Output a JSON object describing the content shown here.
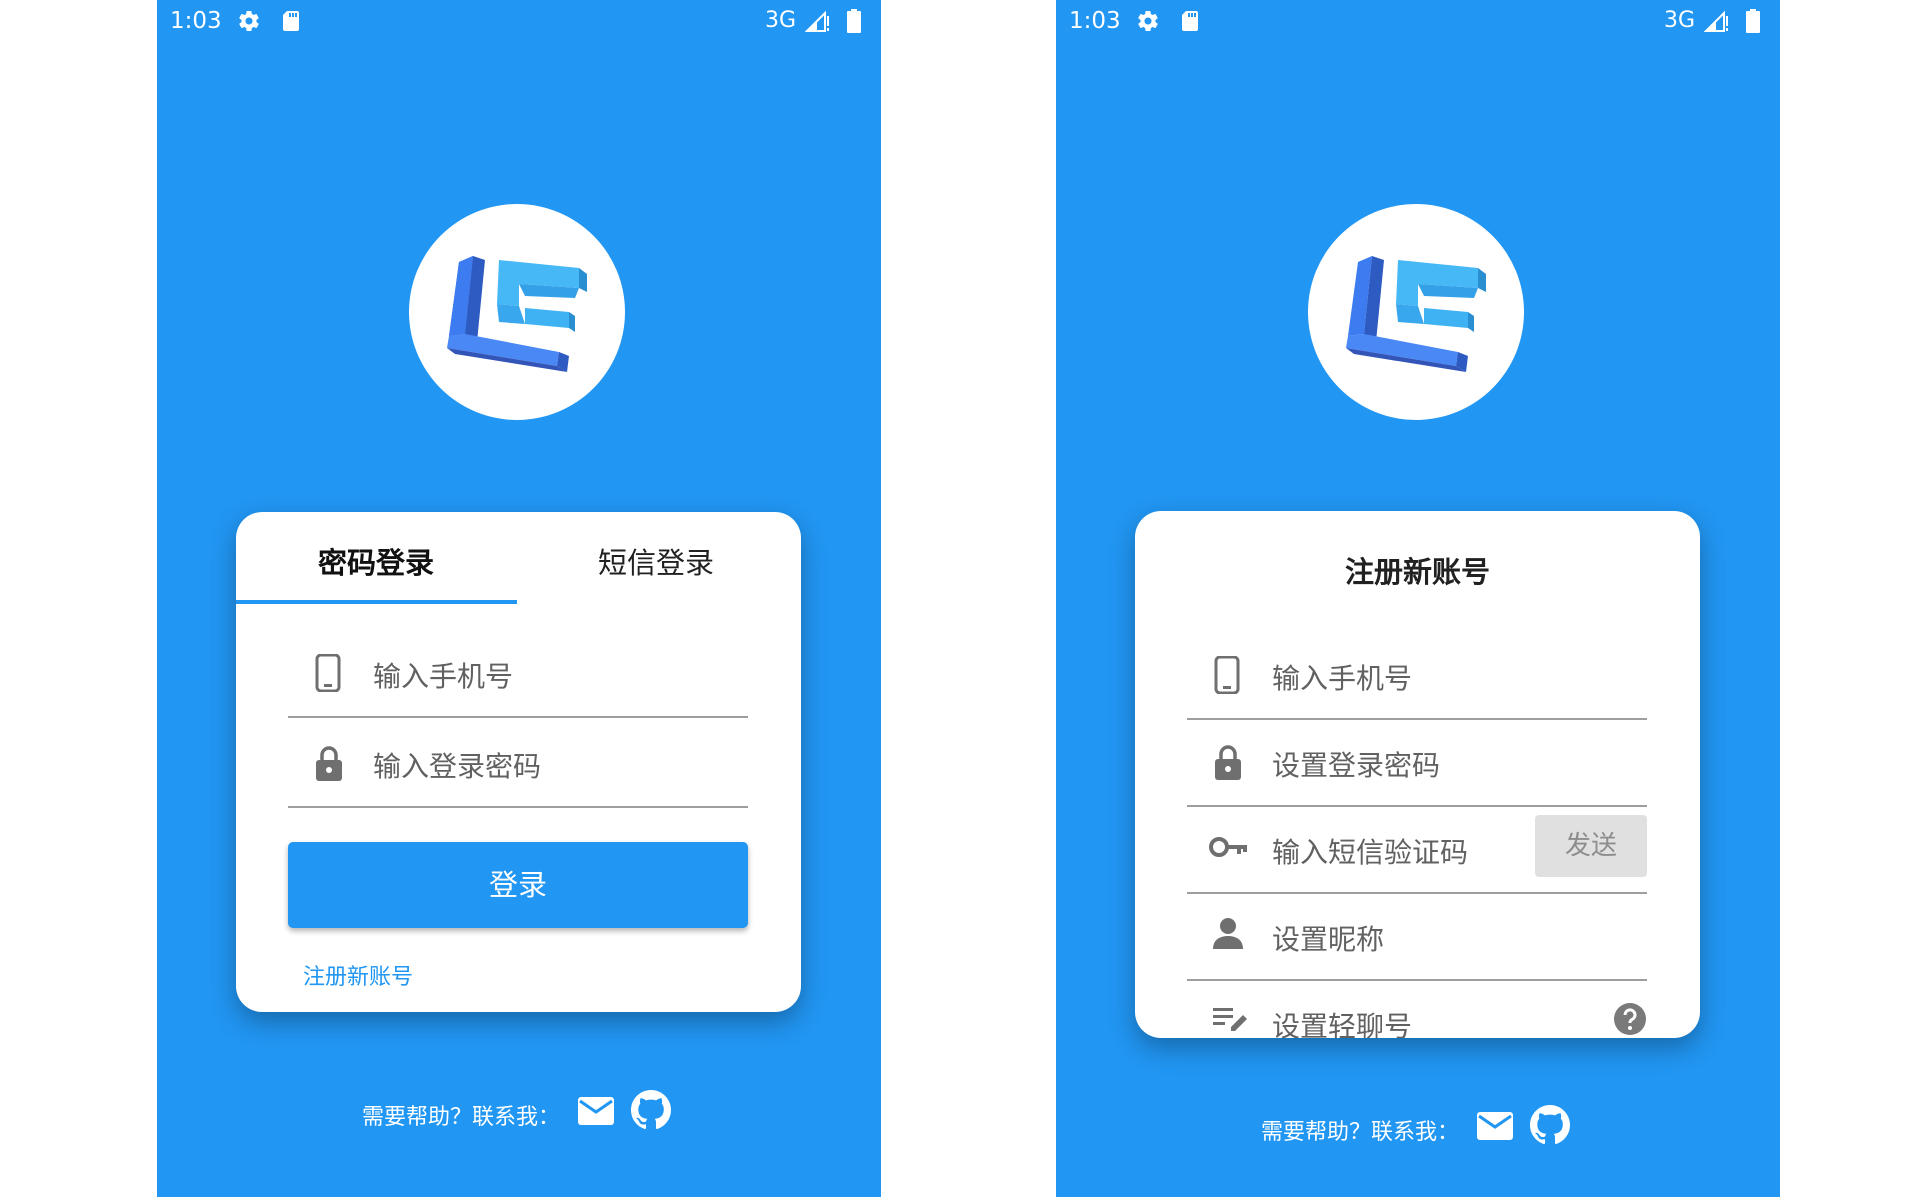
{
  "colors": {
    "primary": "#2196F3",
    "card": "#ffffff",
    "text": "#212121",
    "hint": "#616161"
  },
  "status_bar": {
    "time": "1:03",
    "network": "3G",
    "icons": [
      "gear-icon",
      "sd-card-icon",
      "signal-icon",
      "battery-icon"
    ]
  },
  "login_screen": {
    "tabs": [
      {
        "label": "密码登录",
        "active": true
      },
      {
        "label": "短信登录",
        "active": false
      }
    ],
    "fields": [
      {
        "icon": "phone-icon",
        "placeholder": "输入手机号"
      },
      {
        "icon": "lock-icon",
        "placeholder": "输入登录密码"
      }
    ],
    "login_button": "登录",
    "register_link": "注册新账号"
  },
  "register_screen": {
    "title": "注册新账号",
    "fields": [
      {
        "icon": "phone-icon",
        "placeholder": "输入手机号"
      },
      {
        "icon": "lock-icon",
        "placeholder": "设置登录密码"
      },
      {
        "icon": "key-icon",
        "placeholder": "输入短信验证码",
        "action": "发送"
      },
      {
        "icon": "person-icon",
        "placeholder": "设置昵称"
      },
      {
        "icon": "edit-note-icon",
        "placeholder": "设置轻聊号",
        "trailing_icon": "help-icon"
      }
    ]
  },
  "footer": {
    "text": "需要帮助？联系我：",
    "icons": [
      "mail-icon",
      "github-icon"
    ]
  }
}
